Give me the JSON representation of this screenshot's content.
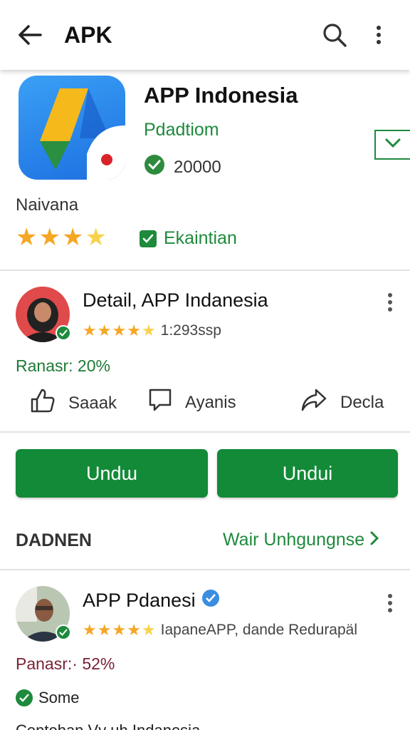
{
  "appbar": {
    "title": "APK"
  },
  "app": {
    "name": "APP Indonesia",
    "developer": "Pdadtiom",
    "count": "20000",
    "sub_label": "Naivana",
    "rating_stars": 3.5,
    "badge": "Ekaintian"
  },
  "post1": {
    "title": "Detail, APP Indanesia",
    "rating_stars": 4.5,
    "meta": "1:293ssp",
    "stat": "Ranasr:  20%",
    "actions": [
      {
        "label": "Saaak",
        "icon": "thumbs-up-icon"
      },
      {
        "label": "Ayanis",
        "icon": "comment-icon"
      },
      {
        "label": "Decla",
        "icon": "share-icon"
      }
    ]
  },
  "buttons": {
    "left": "Undɯ",
    "right": "Undui"
  },
  "section": {
    "title": "DADNEN",
    "link": "Wair Unhgungnse"
  },
  "post2": {
    "title": "APP Pdanesi",
    "rating_stars": 4.5,
    "meta": "IapaneAPP, dande Redurapäl",
    "stat": "Panasr:· 52%",
    "tag": "Some",
    "cut_line": "Contohan Vv  uh  Indanesia"
  },
  "colors": {
    "accent": "#1e8a3c",
    "button": "#138a38",
    "star": "#f5a623"
  }
}
